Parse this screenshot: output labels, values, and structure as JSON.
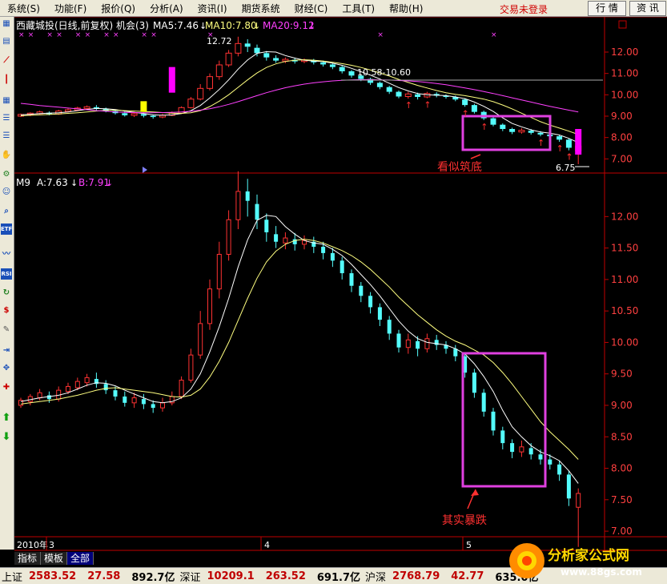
{
  "menubar": {
    "items": [
      "系统(S)",
      "功能(F)",
      "报价(Q)",
      "分析(A)",
      "资讯(I)",
      "期货系统",
      "财经(C)",
      "工具(T)",
      "帮助(H)"
    ],
    "login_status": "交易未登录",
    "buttons": [
      "行 情",
      "资 讯"
    ]
  },
  "toolbar": {
    "icons": [
      "table-icon",
      "table-icon",
      "line-chart-icon",
      "candle-chart-icon",
      "grid-icon",
      "list-icon",
      "list-icon",
      "hand-icon",
      "gear-icon",
      "people-icon",
      "search-icon",
      "etf-icon",
      "wave-icon",
      "rsi-icon",
      "refresh-icon",
      "dollar-icon",
      "tools-icon",
      "export-icon",
      "move-icon",
      "cross-icon",
      "up-arrow-icon",
      "down-arrow-icon"
    ],
    "etf_label": "ETF",
    "rsi_label": "RSI",
    "dollar_label": "$"
  },
  "top_panel": {
    "title": "西藏城投(日线,前复权) 机会(3)",
    "ma5_label": "MA5:7.46",
    "ma10_label": "MA10:7.80",
    "ma20_label": "MA20:9.12",
    "peak_label": "12.72",
    "range_label": "10.58-10.60",
    "low_label": "6.75",
    "annotation": "看似筑底",
    "y_ticks": [
      "12.00",
      "11.00",
      "10.00",
      "9.00",
      "8.00",
      "7.00"
    ]
  },
  "bottom_panel": {
    "title": "M9",
    "a_label": "A:7.63",
    "b_label": "B:7.91",
    "annotation": "其实暴跌",
    "y_ticks": [
      "12.00",
      "11.50",
      "11.00",
      "10.50",
      "10.00",
      "9.50",
      "9.00",
      "8.50",
      "8.00",
      "7.50",
      "7.00"
    ]
  },
  "time_axis": {
    "labels": [
      "2010年",
      "3",
      "4",
      "5"
    ]
  },
  "tabs": [
    "指标",
    "模板",
    "全部"
  ],
  "statusbar": [
    {
      "name": "上证",
      "price": "2583.52",
      "change": "27.58",
      "volume": "892.7亿"
    },
    {
      "name": "深证",
      "price": "10209.1",
      "change": "263.52",
      "volume": "691.7亿"
    },
    {
      "name": "沪深",
      "price": "2768.79",
      "change": "42.77",
      "volume": "635.0亿"
    }
  ],
  "watermark": {
    "title": "分析家公式网",
    "url": "www.88gs.com"
  },
  "colors": {
    "up": "#ff3232",
    "down": "#54fcfc",
    "ma5": "#ffffff",
    "ma10": "#ffff80",
    "ma20": "#ff40ff",
    "box": "#e040e0",
    "axis": "#c00000"
  },
  "chart_data": {
    "type": "candlestick",
    "title": "西藏城投(日线,前复权)",
    "days": 60,
    "candles": [
      {
        "o": 9.0,
        "c": 9.08,
        "h": 9.12,
        "l": 8.96
      },
      {
        "o": 9.06,
        "c": 9.14,
        "h": 9.18,
        "l": 9.0
      },
      {
        "o": 9.12,
        "c": 9.2,
        "h": 9.26,
        "l": 9.08
      },
      {
        "o": 9.16,
        "c": 9.1,
        "h": 9.22,
        "l": 9.04
      },
      {
        "o": 9.1,
        "c": 9.24,
        "h": 9.3,
        "l": 9.06
      },
      {
        "o": 9.22,
        "c": 9.3,
        "h": 9.36,
        "l": 9.18
      },
      {
        "o": 9.28,
        "c": 9.38,
        "h": 9.44,
        "l": 9.24
      },
      {
        "o": 9.36,
        "c": 9.44,
        "h": 9.5,
        "l": 9.3
      },
      {
        "o": 9.42,
        "c": 9.34,
        "h": 9.52,
        "l": 9.28
      },
      {
        "o": 9.34,
        "c": 9.24,
        "h": 9.4,
        "l": 9.18
      },
      {
        "o": 9.24,
        "c": 9.14,
        "h": 9.3,
        "l": 9.08
      },
      {
        "o": 9.14,
        "c": 9.04,
        "h": 9.22,
        "l": 8.98
      },
      {
        "o": 9.04,
        "c": 9.12,
        "h": 9.2,
        "l": 8.96
      },
      {
        "o": 9.1,
        "c": 9.02,
        "h": 9.18,
        "l": 8.94
      },
      {
        "o": 9.02,
        "c": 8.96,
        "h": 9.08,
        "l": 8.88
      },
      {
        "o": 8.96,
        "c": 9.04,
        "h": 9.12,
        "l": 8.9
      },
      {
        "o": 9.04,
        "c": 9.14,
        "h": 9.22,
        "l": 9.0
      },
      {
        "o": 9.14,
        "c": 9.4,
        "h": 9.46,
        "l": 9.1
      },
      {
        "o": 9.4,
        "c": 9.8,
        "h": 9.9,
        "l": 9.36
      },
      {
        "o": 9.8,
        "c": 10.3,
        "h": 10.5,
        "l": 9.74
      },
      {
        "o": 10.3,
        "c": 10.85,
        "h": 11.0,
        "l": 10.2
      },
      {
        "o": 10.85,
        "c": 11.4,
        "h": 11.6,
        "l": 10.7
      },
      {
        "o": 11.4,
        "c": 11.95,
        "h": 12.1,
        "l": 11.3
      },
      {
        "o": 11.95,
        "c": 12.4,
        "h": 12.72,
        "l": 11.8
      },
      {
        "o": 12.4,
        "c": 12.25,
        "h": 12.6,
        "l": 12.0
      },
      {
        "o": 12.2,
        "c": 11.95,
        "h": 12.35,
        "l": 11.8
      },
      {
        "o": 11.95,
        "c": 11.75,
        "h": 12.05,
        "l": 11.6
      },
      {
        "o": 11.72,
        "c": 11.6,
        "h": 11.85,
        "l": 11.5
      },
      {
        "o": 11.58,
        "c": 11.66,
        "h": 11.75,
        "l": 11.48
      },
      {
        "o": 11.64,
        "c": 11.56,
        "h": 11.74,
        "l": 11.46
      },
      {
        "o": 11.56,
        "c": 11.62,
        "h": 11.7,
        "l": 11.48
      },
      {
        "o": 11.6,
        "c": 11.52,
        "h": 11.68,
        "l": 11.42
      },
      {
        "o": 11.52,
        "c": 11.42,
        "h": 11.6,
        "l": 11.32
      },
      {
        "o": 11.42,
        "c": 11.3,
        "h": 11.5,
        "l": 11.2
      },
      {
        "o": 11.3,
        "c": 11.1,
        "h": 11.36,
        "l": 11.0
      },
      {
        "o": 11.1,
        "c": 10.9,
        "h": 11.16,
        "l": 10.8
      },
      {
        "o": 10.9,
        "c": 10.74,
        "h": 10.96,
        "l": 10.64
      },
      {
        "o": 10.74,
        "c": 10.56,
        "h": 10.8,
        "l": 10.46
      },
      {
        "o": 10.56,
        "c": 10.36,
        "h": 10.62,
        "l": 10.26
      },
      {
        "o": 10.36,
        "c": 10.14,
        "h": 10.42,
        "l": 10.04
      },
      {
        "o": 10.14,
        "c": 9.92,
        "h": 10.2,
        "l": 9.84
      },
      {
        "o": 9.92,
        "c": 10.04,
        "h": 10.14,
        "l": 9.82
      },
      {
        "o": 10.02,
        "c": 9.9,
        "h": 10.1,
        "l": 9.78
      },
      {
        "o": 9.9,
        "c": 10.06,
        "h": 10.14,
        "l": 9.84
      },
      {
        "o": 10.04,
        "c": 9.96,
        "h": 10.12,
        "l": 9.88
      },
      {
        "o": 9.96,
        "c": 9.9,
        "h": 10.02,
        "l": 9.82
      },
      {
        "o": 9.9,
        "c": 9.78,
        "h": 9.96,
        "l": 9.7
      },
      {
        "o": 9.78,
        "c": 9.52,
        "h": 9.84,
        "l": 9.44
      },
      {
        "o": 9.52,
        "c": 9.2,
        "h": 9.58,
        "l": 9.12
      },
      {
        "o": 9.2,
        "c": 8.9,
        "h": 9.26,
        "l": 8.82
      },
      {
        "o": 8.9,
        "c": 8.6,
        "h": 8.96,
        "l": 8.52
      },
      {
        "o": 8.6,
        "c": 8.4,
        "h": 8.66,
        "l": 8.3
      },
      {
        "o": 8.4,
        "c": 8.26,
        "h": 8.46,
        "l": 8.16
      },
      {
        "o": 8.26,
        "c": 8.34,
        "h": 8.44,
        "l": 8.18
      },
      {
        "o": 8.32,
        "c": 8.22,
        "h": 8.4,
        "l": 8.14
      },
      {
        "o": 8.22,
        "c": 8.14,
        "h": 8.3,
        "l": 8.06
      },
      {
        "o": 8.14,
        "c": 8.06,
        "h": 8.22,
        "l": 7.98
      },
      {
        "o": 8.06,
        "c": 7.9,
        "h": 8.12,
        "l": 7.8
      },
      {
        "o": 7.9,
        "c": 7.52,
        "h": 7.96,
        "l": 7.4
      },
      {
        "o": 7.38,
        "c": 7.6,
        "h": 7.68,
        "l": 6.75
      }
    ],
    "ma5": [
      9.06,
      9.09,
      9.12,
      9.14,
      9.16,
      9.2,
      9.26,
      9.32,
      9.36,
      9.35,
      9.31,
      9.24,
      9.18,
      9.12,
      9.06,
      9.04,
      9.06,
      9.12,
      9.26,
      9.5,
      9.85,
      10.25,
      10.7,
      11.2,
      11.63,
      11.94,
      12.02,
      12.0,
      11.84,
      11.72,
      11.62,
      11.58,
      11.56,
      11.48,
      11.38,
      11.24,
      11.08,
      10.92,
      10.74,
      10.54,
      10.34,
      10.18,
      10.06,
      10.0,
      9.98,
      9.96,
      9.9,
      9.82,
      9.66,
      9.46,
      9.22,
      8.92,
      8.66,
      8.5,
      8.36,
      8.26,
      8.2,
      8.12,
      7.96,
      7.76
    ],
    "ma10": [
      9.02,
      9.04,
      9.06,
      9.08,
      9.1,
      9.13,
      9.16,
      9.2,
      9.24,
      9.27,
      9.28,
      9.26,
      9.24,
      9.22,
      9.2,
      9.17,
      9.14,
      9.13,
      9.16,
      9.26,
      9.45,
      9.7,
      10.0,
      10.35,
      10.7,
      11.02,
      11.28,
      11.45,
      11.56,
      11.62,
      11.64,
      11.62,
      11.58,
      11.52,
      11.46,
      11.38,
      11.28,
      11.16,
      11.02,
      10.88,
      10.72,
      10.58,
      10.44,
      10.32,
      10.2,
      10.1,
      10.02,
      9.96,
      9.88,
      9.8,
      9.68,
      9.52,
      9.34,
      9.14,
      8.94,
      8.74,
      8.58,
      8.44,
      8.3,
      8.14
    ],
    "ma20": [
      9.6,
      9.55,
      9.5,
      9.46,
      9.42,
      9.38,
      9.34,
      9.3,
      9.26,
      9.23,
      9.2,
      9.18,
      9.17,
      9.16,
      9.16,
      9.17,
      9.18,
      9.2,
      9.23,
      9.28,
      9.35,
      9.44,
      9.55,
      9.68,
      9.82,
      9.96,
      10.1,
      10.22,
      10.33,
      10.42,
      10.5,
      10.56,
      10.61,
      10.65,
      10.68,
      10.7,
      10.71,
      10.71,
      10.7,
      10.69,
      10.67,
      10.65,
      10.62,
      10.58,
      10.53,
      10.47,
      10.4,
      10.32,
      10.24,
      10.15,
      10.06,
      9.96,
      9.86,
      9.76,
      9.66,
      9.56,
      9.46,
      9.37,
      9.28,
      9.2
    ],
    "top_ylim": [
      6.6,
      12.9
    ],
    "bottom_ylim": [
      6.95,
      12.45
    ],
    "y_axis_side": "right",
    "grid": false
  }
}
